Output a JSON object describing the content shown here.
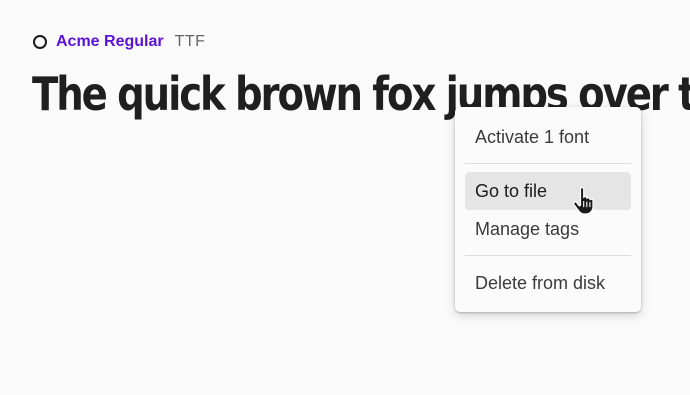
{
  "font": {
    "status_icon": "circle-outline-icon",
    "name": "Acme Regular",
    "format": "TTF",
    "preview": "The quick brown fox jumps over the lazy dog",
    "name_color": "#5b12d6"
  },
  "context_menu": {
    "items": [
      {
        "label": "Activate 1 font"
      },
      {
        "label": "Go to file",
        "hovered": true
      },
      {
        "label": "Manage tags"
      },
      {
        "label": "Delete from disk"
      }
    ]
  },
  "cursor": {
    "icon": "hand-pointer-icon"
  }
}
